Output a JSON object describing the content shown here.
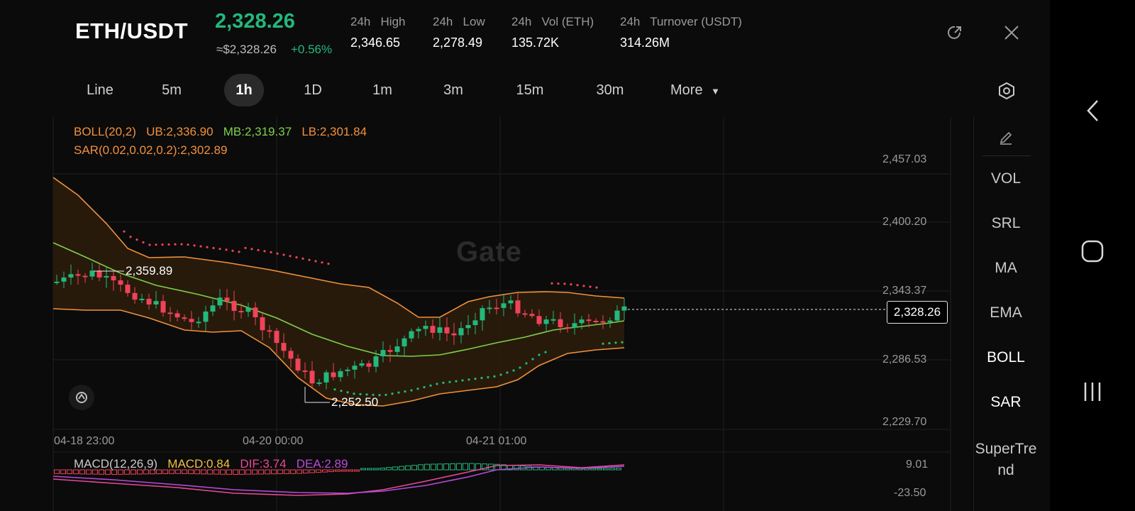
{
  "header": {
    "pair": "ETH/USDT",
    "price": "2,328.26",
    "price_usd": "≈$2,328.26",
    "change": "+0.56%",
    "stats": [
      {
        "label": "24h   High",
        "value": "2,346.65"
      },
      {
        "label": "24h   Low",
        "value": "2,278.49"
      },
      {
        "label": "24h   Vol (ETH)",
        "value": "135.72K"
      },
      {
        "label": "24h   Turnover (USDT)",
        "value": "314.26M"
      }
    ]
  },
  "tabs": [
    "Line",
    "5m",
    "1h",
    "1D",
    "1m",
    "3m",
    "15m",
    "30m",
    "More"
  ],
  "active_tab": "1h",
  "indicators": {
    "boll_name": "BOLL(20,2)",
    "boll_ub": "UB:2,336.90",
    "boll_mb": "MB:2,319.37",
    "boll_lb": "LB:2,301.84",
    "sar": "SAR(0.02,0.02,0.2):2,302.89",
    "macd_name": "MACD(12,26,9)",
    "macd_val": "MACD:0.84",
    "dif": "DIF:3.74",
    "dea": "DEA:2.89"
  },
  "watermark": "Gate",
  "y_axis": [
    "2,457.03",
    "2,400.20",
    "2,343.37",
    "2,286.53",
    "2,229.70"
  ],
  "x_axis": [
    "04-18 23:00",
    "04-20 00:00",
    "04-21 01:00"
  ],
  "macd_axis": [
    "9.01",
    "-23.50"
  ],
  "annotations": {
    "high": "2,359.89",
    "low": "2,252.50"
  },
  "current_price_tag": "2,328.26",
  "side_panel": [
    "VOL",
    "SRL",
    "MA",
    "EMA",
    "BOLL",
    "SAR",
    "SuperTre\nnd"
  ],
  "side_active": [
    "BOLL",
    "SAR"
  ],
  "colors": {
    "up": "#23b87c",
    "down": "#f0435a",
    "upper_band": "#f2913d",
    "mid_band": "#7ed04b",
    "macd_dif": "#e64996",
    "macd_dea": "#b84ad9"
  },
  "icons": [
    "share-icon",
    "close-icon",
    "settings-icon",
    "pencil-icon",
    "chart-logo-icon",
    "back-icon",
    "home-icon",
    "recents-icon"
  ]
}
